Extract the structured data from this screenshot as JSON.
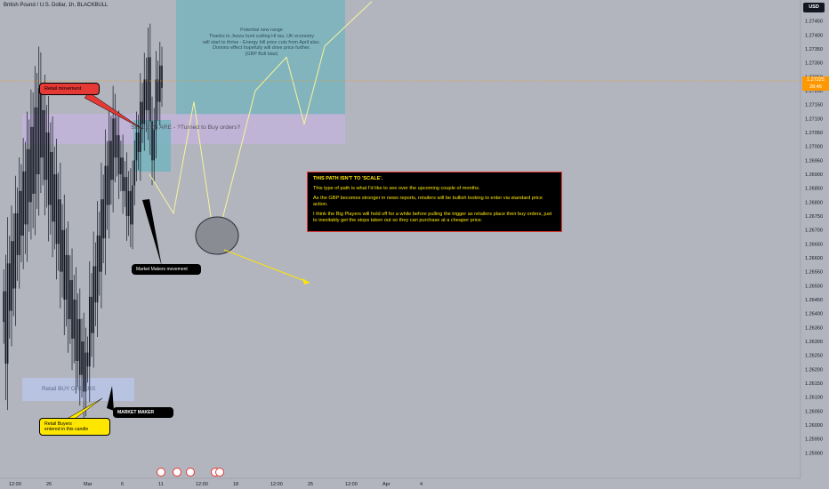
{
  "header": {
    "title": "British Pound / U.S. Dollar, 1h, BLACKBULL",
    "currency": "USD"
  },
  "price_tag": {
    "price": "1.27225",
    "countdown": "28:45"
  },
  "annotations": {
    "retail_movement": "Retail movement",
    "sellers_zone": "SELLERS ARE - ?Turned to Buy orders?",
    "market_makers_movement": "Market Makers movement",
    "retail_buy_orders": "Retail BUY ORDERS",
    "market_maker": "MARKET MAKER",
    "retail_buyers": [
      "Retail Buyers",
      "entered in this candle"
    ],
    "potential_range": [
      "Potential new range",
      "Thanks to Jezza hunt cutting HI tax, UK economy",
      "will start to thrive - Energy bill price cuts from April also.",
      "Domino effect hopefully will drive price further.",
      "(GBP Bull bias)"
    ],
    "path_note": [
      "THIS PATH ISN'T TO 'SCALE'.",
      "This type of path is what I'd like to see over the upcoming couple of months.",
      "As the GBP becomes stronger in news reports, retailers will be bullish looking to enter via standard price action.",
      "I think the Big Players will hold off for a while before pulling the trigger as retailers place their buy orders, just to inevitably get the stops taken out so they can purchase at a cheaper price."
    ]
  },
  "colors": {
    "background": "#b2b5be",
    "candle": "#131722",
    "zone_purple": "#c3b4dc",
    "zone_teal": "#71b4bd",
    "zone_blue": "#b8c6e8",
    "path_line": "#f7f59a",
    "accent_red": "#e53935",
    "accent_yellow": "#ffe600",
    "price_tag": "#ff9800"
  },
  "chart_data": {
    "type": "line",
    "ylim": [
      1.2585,
      1.275
    ],
    "y_ticks": [
      1.2745,
      1.274,
      1.2735,
      1.273,
      1.2725,
      1.272,
      1.2715,
      1.271,
      1.2705,
      1.27,
      1.2695,
      1.269,
      1.2685,
      1.268,
      1.2675,
      1.267,
      1.2665,
      1.266,
      1.2655,
      1.265,
      1.2645,
      1.264,
      1.2635,
      1.263,
      1.2625,
      1.262,
      1.2615,
      1.261,
      1.2605,
      1.26,
      1.2595,
      1.259
    ],
    "x_ticks": [
      "12:00",
      "26",
      "Mar",
      "6",
      "11",
      "12:00",
      "18",
      "12:00",
      "25",
      "12:00",
      "Apr",
      "4"
    ],
    "current_price": 1.27225,
    "candle_series": {
      "name": "",
      "values": [
        1.2637,
        1.2648,
        1.2622,
        1.2658,
        1.2641,
        1.2666,
        1.2649,
        1.2676,
        1.2661,
        1.2684,
        1.2668,
        1.2691,
        1.2672,
        1.2699,
        1.268,
        1.2707,
        1.2683,
        1.2714,
        1.269,
        1.2721,
        1.2696,
        1.2713,
        1.2688,
        1.2705,
        1.2679,
        1.2698,
        1.2673,
        1.269,
        1.2665,
        1.2681,
        1.2655,
        1.267,
        1.2645,
        1.2661,
        1.2638,
        1.2652,
        1.2631,
        1.2645,
        1.2623,
        1.2638,
        1.2618,
        1.263,
        1.2612,
        1.2626,
        1.2621,
        1.2646,
        1.2633,
        1.2657,
        1.2644,
        1.2668,
        1.2655,
        1.2681,
        1.2667,
        1.2693,
        1.2679,
        1.2702,
        1.2688,
        1.271,
        1.2696,
        1.2704,
        1.269,
        1.2696,
        1.2684,
        1.2689,
        1.2675,
        1.2684,
        1.2672,
        1.2686,
        1.2695,
        1.2705,
        1.2698,
        1.2716,
        1.2708,
        1.2724,
        1.2713,
        1.2732,
        1.2709,
        1.2695,
        1.2706,
        1.2724,
        1.2716,
        1.2729,
        1.2721
      ]
    },
    "projected_path": {
      "name": "",
      "values": [
        1.269,
        1.2676,
        1.2716,
        1.2664,
        1.272,
        1.2732,
        1.2708,
        1.2736,
        1.2752
      ]
    }
  }
}
